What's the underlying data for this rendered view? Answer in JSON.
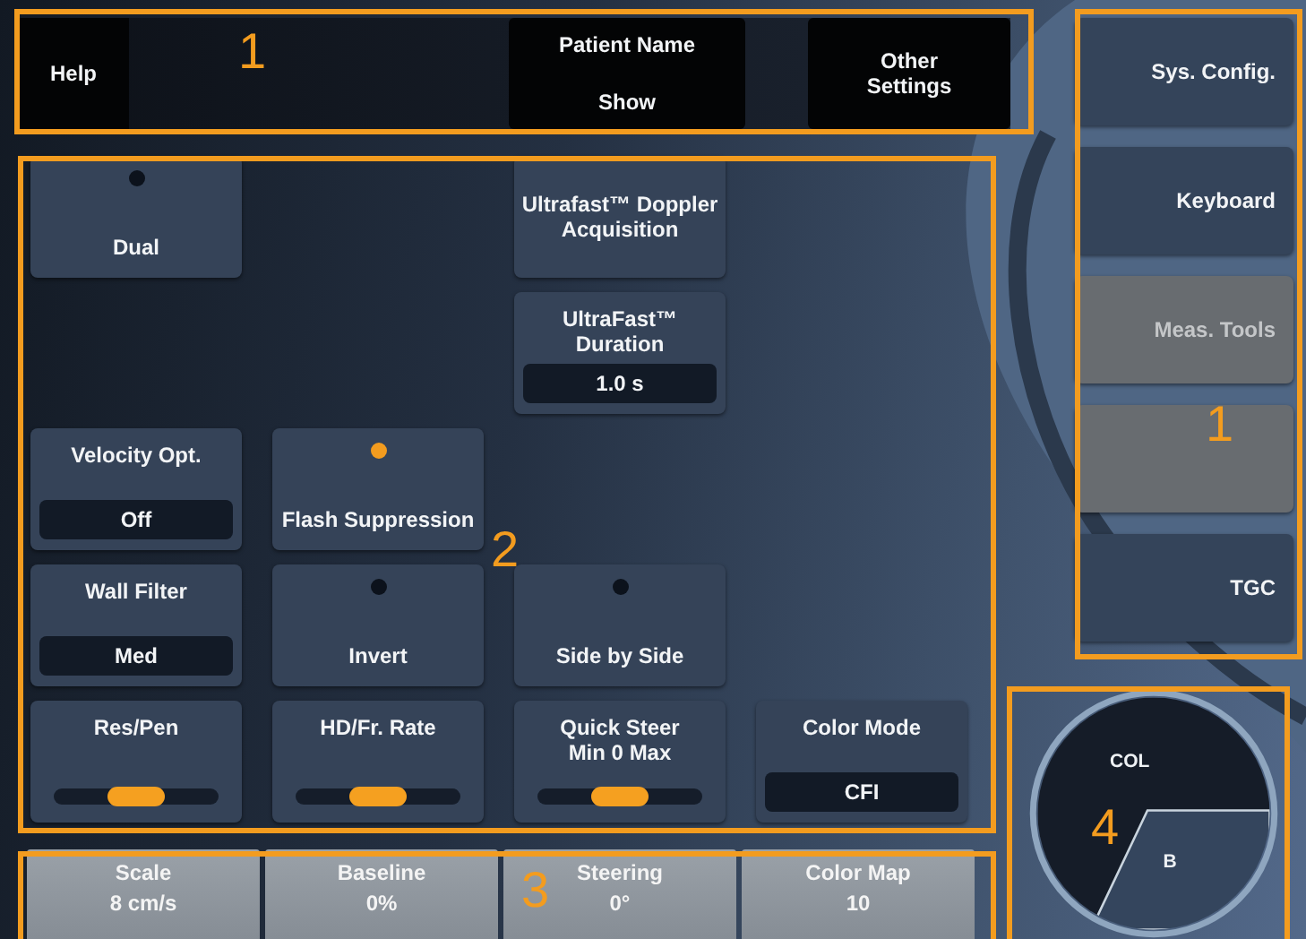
{
  "top_bar": {
    "items": [
      {
        "kind": "plain",
        "label": "Help"
      },
      {
        "kind": "value",
        "label": "Patient Name",
        "value": "Show"
      },
      {
        "kind": "plain",
        "label": "Other Settings"
      }
    ]
  },
  "controls": [
    {
      "kind": "toggle",
      "label": "Dual",
      "on": false
    },
    {
      "kind": "plain",
      "label": "Ultrafast™ Doppler Acquisition"
    },
    {
      "kind": "value",
      "label": "UltraFast™ Duration",
      "value": "1.0 s"
    },
    {
      "kind": "value",
      "label": "Velocity Opt.",
      "value": "Off"
    },
    {
      "kind": "toggle",
      "label": "Flash Suppression",
      "on": true
    },
    {
      "kind": "value",
      "label": "Wall Filter",
      "value": "Med"
    },
    {
      "kind": "toggle",
      "label": "Invert",
      "on": false
    },
    {
      "kind": "toggle",
      "label": "Side by Side",
      "on": false
    },
    {
      "kind": "slider",
      "label": "Res/Pen",
      "level": 0.5
    },
    {
      "kind": "slider",
      "label": "HD/Fr. Rate",
      "level": 0.5
    },
    {
      "kind": "slider",
      "label": "Quick Steer",
      "sublabel": "Min  0  Max",
      "level": 0.5
    },
    {
      "kind": "value",
      "label": "Color Mode",
      "value": "CFI"
    }
  ],
  "bottom_bar": [
    {
      "label": "Scale",
      "value": "8 cm/s"
    },
    {
      "label": "Baseline",
      "value": "0%"
    },
    {
      "label": "Steering",
      "value": "0°"
    },
    {
      "label": "Color Map",
      "value": "10"
    }
  ],
  "side_buttons": [
    {
      "label": "Sys. Config.",
      "disabled": false
    },
    {
      "label": "Keyboard",
      "disabled": false
    },
    {
      "label": "Meas. Tools",
      "disabled": true
    },
    {
      "disabled": true
    },
    {
      "label": "TGC",
      "disabled": false
    }
  ],
  "mode_dial": [
    {
      "label": "COL",
      "selected": true
    },
    {
      "label": "B",
      "selected": false
    }
  ],
  "callouts": [
    {
      "label": "1"
    },
    {
      "label": "1"
    },
    {
      "label": "2"
    },
    {
      "label": "3"
    },
    {
      "label": "4"
    }
  ]
}
